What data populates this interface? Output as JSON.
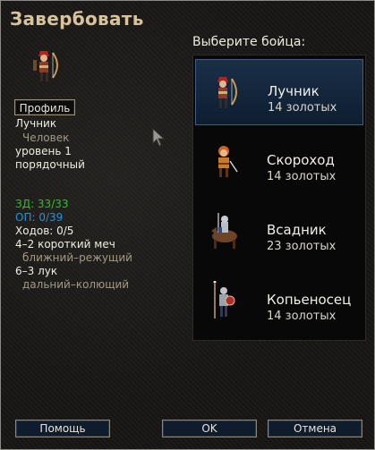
{
  "dialog": {
    "title": "Завербовать",
    "choose_label": "Выберите бойца:"
  },
  "selected_unit": {
    "profile_button": "Профиль",
    "name": "Лучник",
    "race": "Человек",
    "level": "уровень 1",
    "alignment": "порядочный",
    "hp": "ЗД: 33/33",
    "xp": "ОП: 0/39",
    "moves": "Ходов: 0/5",
    "attack1": "4–2 короткий меч",
    "attack1_type": "ближний–режущий",
    "attack2": "6–3 лук",
    "attack2_type": "дальний–колющий"
  },
  "recruit_list": [
    {
      "name": "Лучник",
      "cost": "14 золотых",
      "icon": "bowman-sprite-icon",
      "selected": true
    },
    {
      "name": "Скороход",
      "cost": "14 золотых",
      "icon": "fencer-sprite-icon",
      "selected": false
    },
    {
      "name": "Всадник",
      "cost": "23 золотых",
      "icon": "cavalryman-sprite-icon",
      "selected": false
    },
    {
      "name": "Копьеносец",
      "cost": "14 золотых",
      "icon": "spearman-sprite-icon",
      "selected": false
    }
  ],
  "buttons": {
    "help": "Помощь",
    "ok": "OK",
    "cancel": "Отмена"
  },
  "colors": {
    "title": "#d8c49a",
    "hp": "#28c428",
    "xp": "#2e8ed6",
    "selection": "#1a2f48"
  }
}
